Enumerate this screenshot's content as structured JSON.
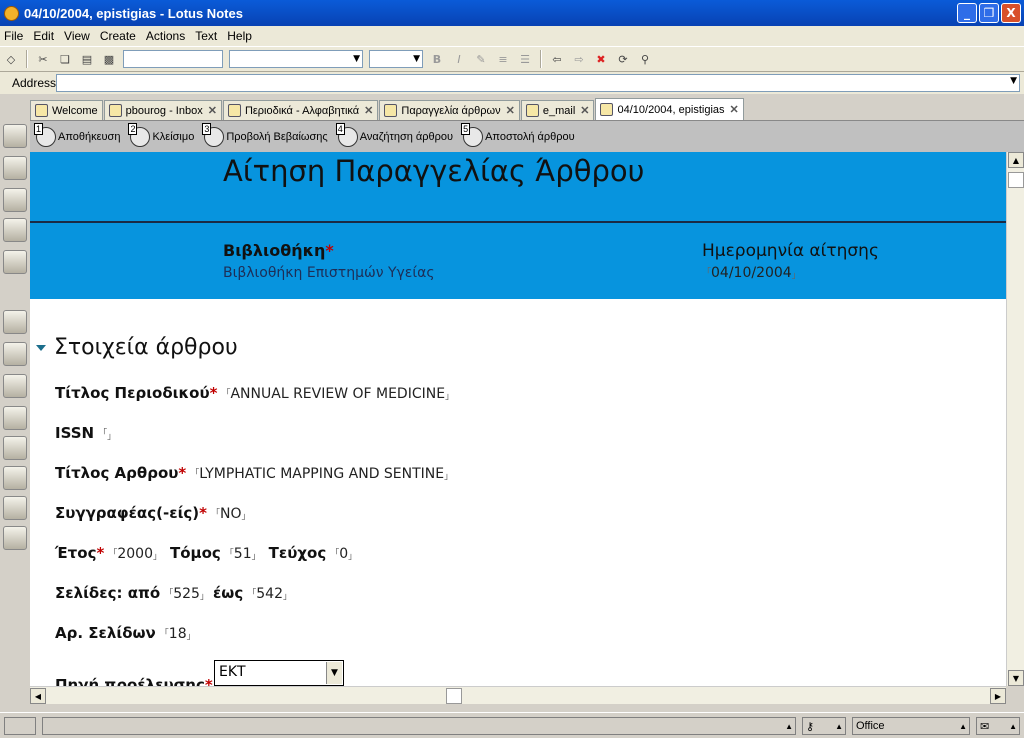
{
  "window": {
    "title": "04/10/2004, epistigias - Lotus Notes",
    "minimize": "_",
    "maximize": "❒",
    "close": "X"
  },
  "menu": [
    "File",
    "Edit",
    "View",
    "Create",
    "Actions",
    "Text",
    "Help"
  ],
  "toolbar": {
    "bold": "B",
    "italic": "I"
  },
  "address": {
    "label": "Address",
    "value": ""
  },
  "tabs": [
    {
      "label": "Welcome"
    },
    {
      "label": "pbourog - Inbox"
    },
    {
      "label": "Περιοδικά - Αλφαβητικά"
    },
    {
      "label": "Παραγγελία άρθρων"
    },
    {
      "label": "e_mail"
    },
    {
      "label": "04/10/2004, epistigias"
    }
  ],
  "actions": [
    {
      "num": "1",
      "label": "Αποθήκευση"
    },
    {
      "num": "2",
      "label": "Κλείσιμο"
    },
    {
      "num": "3",
      "label": "Προβολή Βεβαίωσης"
    },
    {
      "num": "4",
      "label": "Αναζήτηση άρθρου"
    },
    {
      "num": "5",
      "label": "Αποστολή άρθρου"
    }
  ],
  "form": {
    "title": "Αίτηση Παραγγελίας Άρθρου",
    "library_label": "Βιβλιοθήκη",
    "library_value": "Βιβλιοθήκη Επιστημών Υγείας",
    "date_label": "Ημερομηνία αίτησης",
    "date_value": "04/10/2004",
    "section_title": "Στοιχεία άρθρου",
    "required_mark": "*",
    "fields": {
      "journal_label": "Τίτλος Περιοδικού",
      "journal_value": "ANNUAL REVIEW OF MEDICINE",
      "issn_label": "ISSN",
      "issn_value": "",
      "article_label": "Τίτλος Αρθρου",
      "article_value": "LYMPHATIC MAPPING AND SENTINE",
      "authors_label": "Συγγραφέας(-είς)",
      "authors_value": "NO",
      "year_label": "Έτος",
      "year_value": "2000",
      "volume_label": "Τόμος",
      "volume_value": "51",
      "issue_label": "Τεύχος",
      "issue_value": "0",
      "pages_label": "Σελίδες: από",
      "pages_from": "525",
      "pages_to_label": "έως",
      "pages_to": "542",
      "num_pages_label": "Αρ. Σελίδων",
      "num_pages_value": "18",
      "source_label": "Πηγή προέλευσης",
      "source_value": "ΕΚΤ"
    }
  },
  "status": {
    "location": "Office"
  },
  "colors": {
    "header_band": "#0794de",
    "titlebar": "#0a5bd8",
    "required": "#c00000"
  }
}
